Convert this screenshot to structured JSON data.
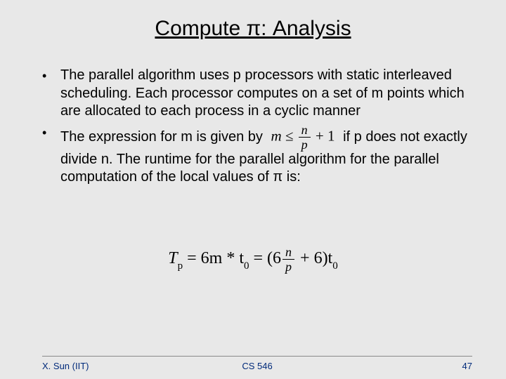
{
  "title": "Compute π: Analysis",
  "bullets": {
    "b1": "The parallel algorithm uses p processors with static interleaved scheduling. Each processor computes on a set of m points which are allocated to each process in a cyclic manner",
    "b2_lead": "The expression for m is given by ",
    "b2_math_lhs": "m ≤",
    "b2_math_num": "n",
    "b2_math_den": "p",
    "b2_math_tail": " + 1",
    "b2_tail": " if p does not exactly divide n. The runtime for the parallel algorithm for the parallel computation of the local values of π is:"
  },
  "equation": {
    "Tp": "T",
    "sub_p": "p",
    "eq1": " = 6m * t",
    "sub0a": "0",
    "eq2": " = (6",
    "frac_num": "n",
    "frac_den": "p",
    "eq3": " + 6)t",
    "sub0b": "0"
  },
  "footer": {
    "left": "X. Sun (IIT)",
    "center": "CS 546",
    "right": "47"
  }
}
